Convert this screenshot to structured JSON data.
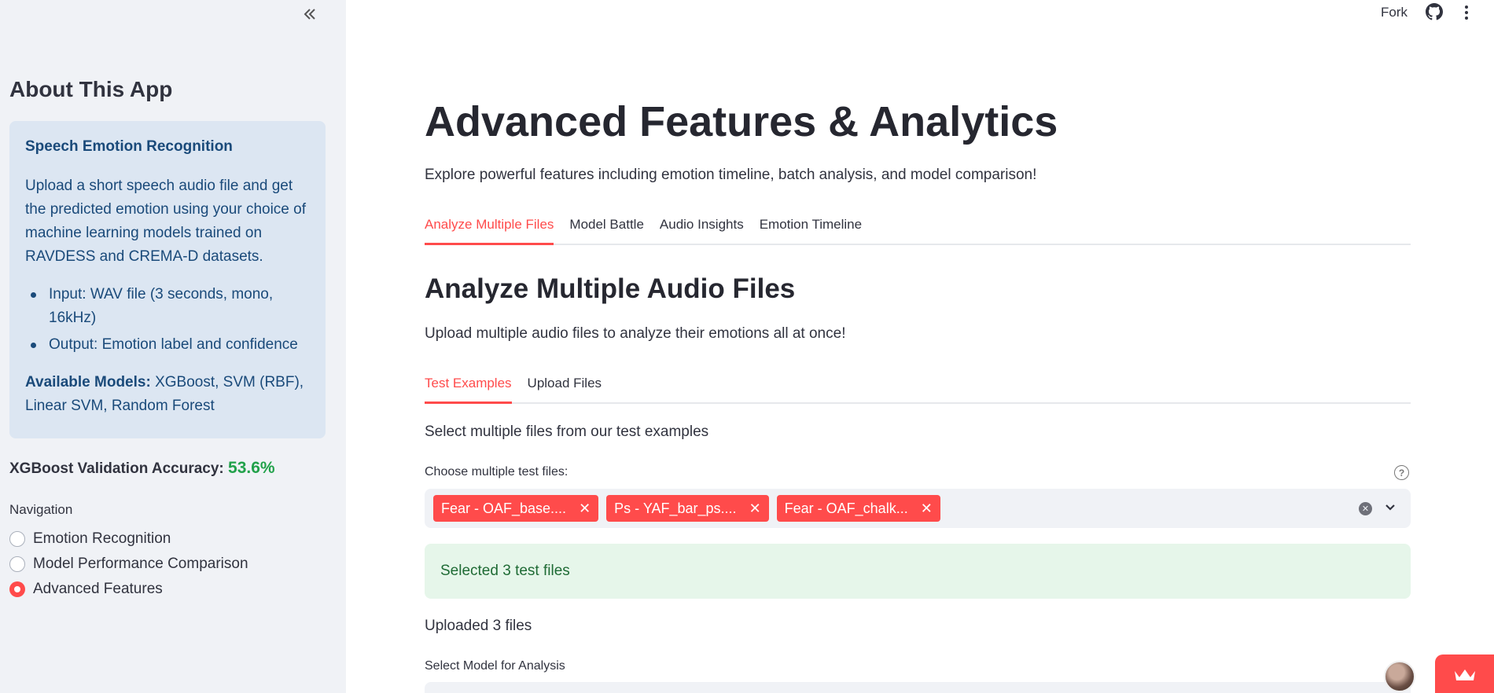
{
  "sidebar": {
    "collapse_icon": "double-chevron-left-icon",
    "title": "About This App",
    "info_box": {
      "title": "Speech Emotion Recognition",
      "description": "Upload a short speech audio file and get the predicted emotion using your choice of machine learning models trained on RAVDESS and CREMA-D datasets.",
      "bullets": [
        "Input: WAV file (3 seconds, mono, 16kHz)",
        "Output: Emotion label and confidence"
      ],
      "models_label": "Available Models:",
      "models_value": "XGBoost, SVM (RBF), Linear SVM, Random Forest"
    },
    "accuracy_label": "XGBoost Validation Accuracy:",
    "accuracy_value": "53.6%",
    "nav_label": "Navigation",
    "nav_items": [
      {
        "label": "Emotion Recognition",
        "selected": false
      },
      {
        "label": "Model Performance Comparison",
        "selected": false
      },
      {
        "label": "Advanced Features",
        "selected": true
      }
    ]
  },
  "topbar": {
    "fork_label": "Fork",
    "github_icon": "github-icon",
    "menu_icon": "kebab-menu-icon"
  },
  "main": {
    "title": "Advanced Features & Analytics",
    "subtitle": "Explore powerful features including emotion timeline, batch analysis, and model comparison!",
    "tabs": [
      {
        "label": "Analyze Multiple Files",
        "active": true
      },
      {
        "label": "Model Battle",
        "active": false
      },
      {
        "label": "Audio Insights",
        "active": false
      },
      {
        "label": "Emotion Timeline",
        "active": false
      }
    ],
    "section_title": "Analyze Multiple Audio Files",
    "section_subtitle": "Upload multiple audio files to analyze their emotions all at once!",
    "sub_tabs": [
      {
        "label": "Test Examples",
        "active": true
      },
      {
        "label": "Upload Files",
        "active": false
      }
    ],
    "select_message": "Select multiple files from our test examples",
    "multiselect_label": "Choose multiple test files:",
    "chips": [
      "Fear - OAF_base....",
      "Ps - YAF_bar_ps....",
      "Fear - OAF_chalk..."
    ],
    "success_message": "Selected 3 test files",
    "uploaded_message": "Uploaded 3 files",
    "model_select_label": "Select Model for Analysis"
  },
  "colors": {
    "accent": "#ff4b4b",
    "sidebar_bg": "#f0f2f6",
    "info_bg": "#dce6f2",
    "info_text": "#1a4a7a",
    "success_bg": "#e6f6ea",
    "success_text": "#1f6b35",
    "accuracy_green": "#21a14a"
  }
}
